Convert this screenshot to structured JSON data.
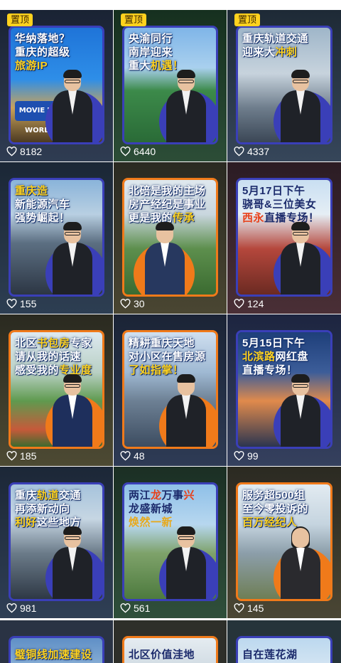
{
  "pin_label": "置顶",
  "tiles": [
    {
      "headline": [
        "华纳落地？",
        "重庆的超级",
        "旅游IP"
      ],
      "highlight": "旅游IP",
      "likes": "8182",
      "pinned": true,
      "sign": "MOVIE WB WORLD"
    },
    {
      "headline": [
        "央渝同行",
        "南岸迎来",
        "重大机遇！"
      ],
      "highlight": "机遇！",
      "likes": "6440",
      "pinned": true
    },
    {
      "headline": [
        "重庆轨道交通",
        "迎来大冲刺"
      ],
      "highlight": "冲刺",
      "likes": "4337",
      "pinned": true
    },
    {
      "headline": [
        "重庆造",
        "新能源汽车",
        "强势崛起！"
      ],
      "highlight": "重庆造",
      "likes": "155"
    },
    {
      "headline": [
        "北碚是我的主场",
        "房产经纪是事业",
        "更是我的传承"
      ],
      "highlight": "传承",
      "likes": "30"
    },
    {
      "headline": [
        "5月17日下午",
        "骁哥&三位美女",
        "西永直播专场！"
      ],
      "highlight": "西永",
      "likes": "124"
    },
    {
      "headline": [
        "北区书包房专家",
        "请从我的话速",
        "感受我的专业度"
      ],
      "highlight": "专业度",
      "likes": "185"
    },
    {
      "headline": [
        "精耕重庆天地",
        "对小区在售房源",
        "了如指掌！"
      ],
      "highlight": "了如指掌！",
      "likes": "48"
    },
    {
      "headline": [
        "5月15日下午",
        "北滨路网红盘",
        "直播专场！"
      ],
      "highlight": "北滨路",
      "likes": "99"
    },
    {
      "headline": [
        "重庆轨道交通",
        "再添新动向",
        "利好这些地方"
      ],
      "highlight": "利好",
      "likes": "981"
    },
    {
      "headline": [
        "两江龙万事兴",
        "龙盛新城",
        "焕然一新"
      ],
      "highlight": "焕然一新",
      "likes": "561"
    },
    {
      "headline": [
        "服务超500组",
        "至今零投诉的",
        "百万经纪人"
      ],
      "highlight": "百万经纪人",
      "likes": "145"
    },
    {
      "headline": [
        "璧铜线加速建设"
      ],
      "highlight": "",
      "likes": ""
    },
    {
      "headline": [
        "北区价值洼地"
      ],
      "highlight": "",
      "likes": ""
    },
    {
      "headline": [
        "自在莲花湖"
      ],
      "highlight": "",
      "likes": ""
    }
  ],
  "colors": {
    "frame_blue": "#3a3fb8",
    "frame_orange": "#f07a1a",
    "pin_yellow": "#ffd21e",
    "highlight": "#ffd21e"
  },
  "icons": {
    "likes": "heart-outline-icon",
    "pin": "pin-badge"
  }
}
